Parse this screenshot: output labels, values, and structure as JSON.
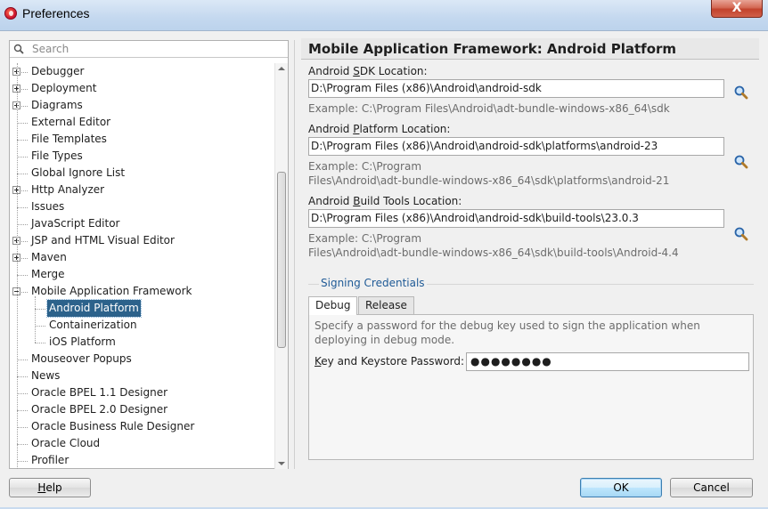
{
  "window": {
    "title": "Preferences",
    "close_glyph": "X"
  },
  "search": {
    "placeholder": "Search"
  },
  "tree": {
    "items": [
      {
        "label": "Debugger",
        "expandable": true
      },
      {
        "label": "Deployment",
        "expandable": true
      },
      {
        "label": "Diagrams",
        "expandable": true
      },
      {
        "label": "External Editor",
        "expandable": false
      },
      {
        "label": "File Templates",
        "expandable": false
      },
      {
        "label": "File Types",
        "expandable": false
      },
      {
        "label": "Global Ignore List",
        "expandable": false
      },
      {
        "label": "Http Analyzer",
        "expandable": true
      },
      {
        "label": "Issues",
        "expandable": false
      },
      {
        "label": "JavaScript Editor",
        "expandable": false
      },
      {
        "label": "JSP and HTML Visual Editor",
        "expandable": true
      },
      {
        "label": "Maven",
        "expandable": true
      },
      {
        "label": "Merge",
        "expandable": false
      },
      {
        "label": "Mobile Application Framework",
        "expandable": true,
        "expanded": true
      },
      {
        "label": "Android Platform",
        "child": true,
        "selected": true
      },
      {
        "label": "Containerization",
        "child": true
      },
      {
        "label": "iOS Platform",
        "child": true
      },
      {
        "label": "Mouseover Popups",
        "expandable": false
      },
      {
        "label": "News",
        "expandable": false
      },
      {
        "label": "Oracle BPEL 1.1 Designer",
        "expandable": false
      },
      {
        "label": "Oracle BPEL 2.0 Designer",
        "expandable": false
      },
      {
        "label": "Oracle Business Rule Designer",
        "expandable": false
      },
      {
        "label": "Oracle Cloud",
        "expandable": false
      },
      {
        "label": "Profiler",
        "expandable": false
      }
    ]
  },
  "page": {
    "title": "Mobile Application Framework: Android Platform",
    "sdk": {
      "label_pre": "Android ",
      "label_mn": "S",
      "label_post": "DK Location:",
      "value": "D:\\Program Files (x86)\\Android\\android-sdk",
      "example": "Example: C:\\Program Files\\Android\\adt-bundle-windows-x86_64\\sdk"
    },
    "platform": {
      "label_pre": "Android ",
      "label_mn": "P",
      "label_post": "latform Location:",
      "value": "D:\\Program Files (x86)\\Android\\android-sdk\\platforms\\android-23",
      "example_line1": "Example: C:\\Program",
      "example_line2": "Files\\Android\\adt-bundle-windows-x86_64\\sdk\\platforms\\android-21"
    },
    "build_tools": {
      "label_pre": "Android ",
      "label_mn": "B",
      "label_post": "uild Tools Location:",
      "value": "D:\\Program Files (x86)\\Android\\android-sdk\\build-tools\\23.0.3",
      "example_line1": "Example: C:\\Program",
      "example_line2": "Files\\Android\\adt-bundle-windows-x86_64\\sdk\\build-tools\\Android-4.4"
    },
    "signing": {
      "group_title": "Signing Credentials",
      "tabs": [
        {
          "label": "Debug",
          "active": true
        },
        {
          "label": "Release",
          "active": false
        }
      ],
      "description": "Specify a password for the debug key used to sign the application when deploying in debug mode.",
      "password_label_pre": "",
      "password_label_mn": "K",
      "password_label_post": "ey and Keystore Password:",
      "password_mask": "●●●●●●●●"
    }
  },
  "buttons": {
    "help_mn": "H",
    "help_rest": "elp",
    "ok": "OK",
    "cancel": "Cancel"
  },
  "colors": {
    "selection": "#2c628b",
    "group_title": "#1f5a96",
    "hint_text": "#6c6c6c"
  },
  "icons": {
    "search": "magnifier-icon",
    "browse": "magnifier-icon",
    "app": "oracle-jdeveloper-icon",
    "close": "close-icon"
  }
}
